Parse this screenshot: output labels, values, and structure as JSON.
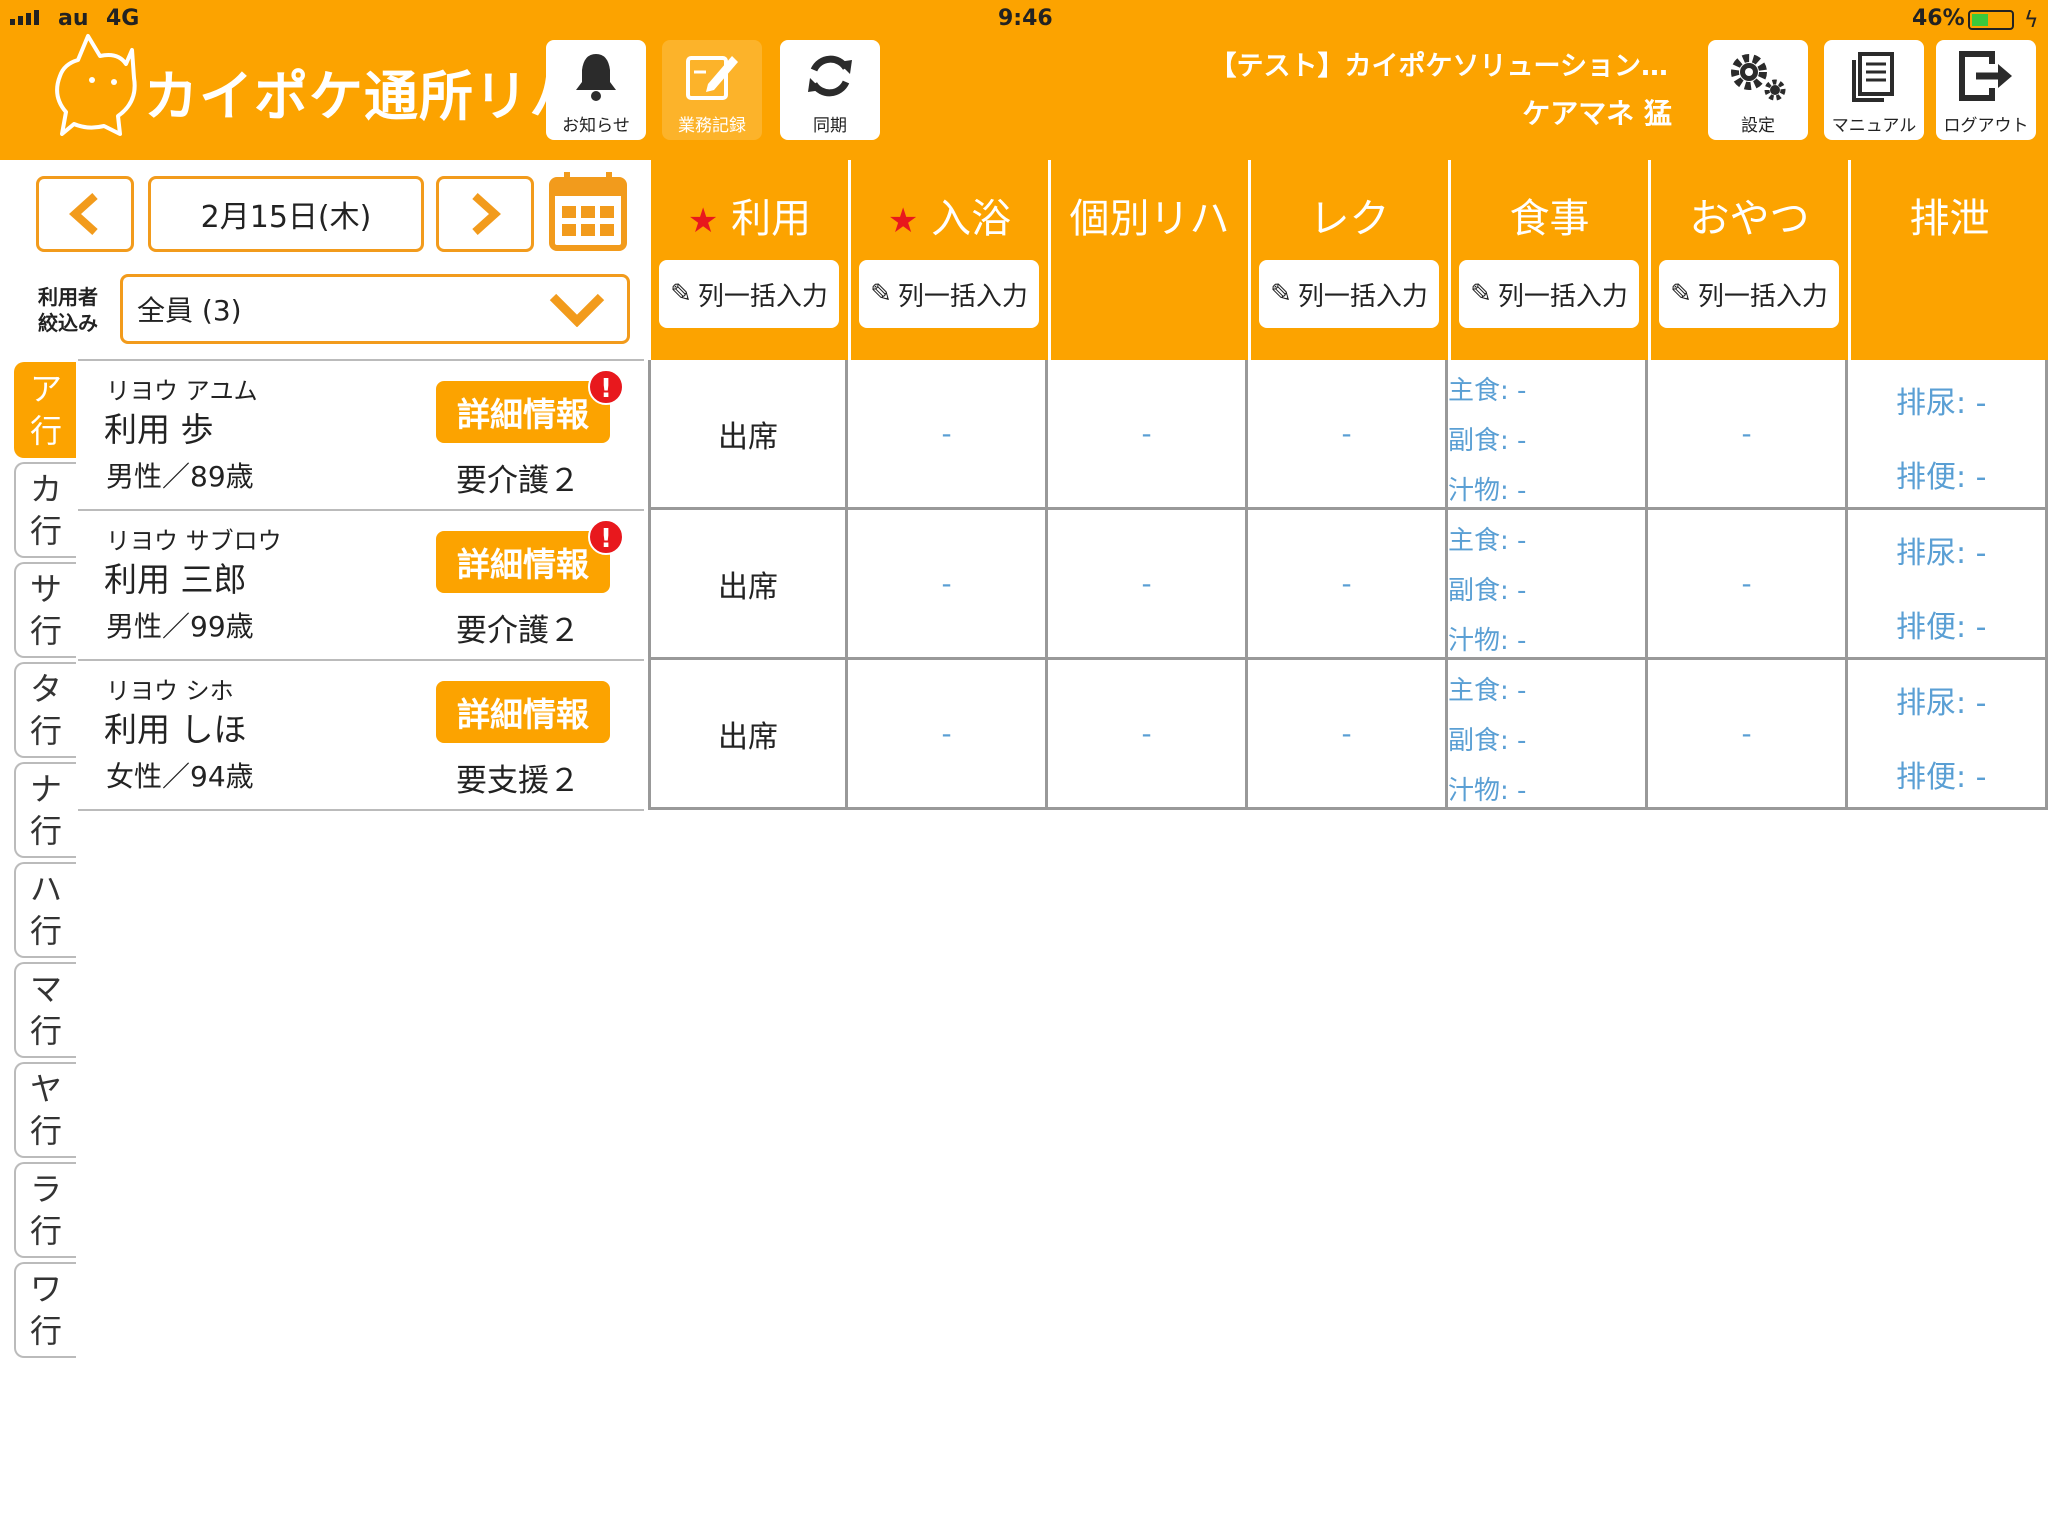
{
  "status_bar": {
    "carrier": "au",
    "network": "4G",
    "time": "9:46",
    "battery": "46%"
  },
  "app": {
    "title": "カイポケ通所リハ"
  },
  "toolbar": {
    "notice": "お知らせ",
    "records": "業務記録",
    "sync": "同期",
    "settings": "設定",
    "manual": "マニュアル",
    "logout": "ログアウト"
  },
  "account": {
    "facility": "【テスト】カイポケソリューション…",
    "user": "ケアマネ 猛"
  },
  "date_nav": {
    "date": "2月15日(木)"
  },
  "filter": {
    "label_line1": "利用者",
    "label_line2": "絞込み",
    "value": "全員 (3)"
  },
  "index_tabs": [
    {
      "top": "ア",
      "bottom": "行"
    },
    {
      "top": "カ",
      "bottom": "行"
    },
    {
      "top": "サ",
      "bottom": "行"
    },
    {
      "top": "タ",
      "bottom": "行"
    },
    {
      "top": "ナ",
      "bottom": "行"
    },
    {
      "top": "ハ",
      "bottom": "行"
    },
    {
      "top": "マ",
      "bottom": "行"
    },
    {
      "top": "ヤ",
      "bottom": "行"
    },
    {
      "top": "ラ",
      "bottom": "行"
    },
    {
      "top": "ワ",
      "bottom": "行"
    }
  ],
  "detail_label": "詳細情報",
  "alert_mark": "!",
  "residents": [
    {
      "kana": "リヨウ アユム",
      "name": "利用 歩",
      "gender_age": "男性／89歳",
      "care_level": "要介護２"
    },
    {
      "kana": "リヨウ サブロウ",
      "name": "利用 三郎",
      "gender_age": "男性／99歳",
      "care_level": "要介護２"
    },
    {
      "kana": "リヨウ シホ",
      "name": "利用 しほ",
      "gender_age": "女性／94歳",
      "care_level": "要支援２"
    }
  ],
  "columns": {
    "star": "★",
    "bulk_label": "列一括入力",
    "use": "利用",
    "bath": "入浴",
    "rehab": "個別リハ",
    "rec": "レク",
    "meal": "食事",
    "snack": "おやつ",
    "excretion": "排泄"
  },
  "cells": {
    "attendance": "出席",
    "dash": "-",
    "meal_main": "主食:",
    "meal_side": "副食:",
    "meal_soup": "汁物:",
    "urine": "排尿:",
    "stool": "排便:"
  }
}
